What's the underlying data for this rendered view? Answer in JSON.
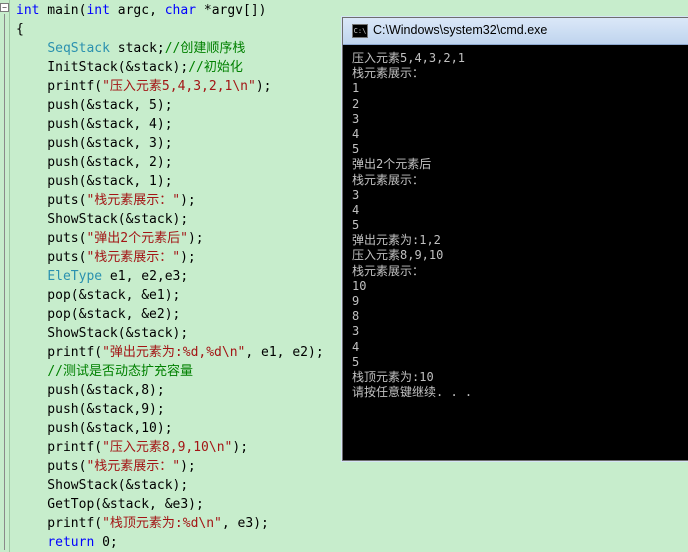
{
  "editor": {
    "lines": [
      [
        {
          "t": "int",
          "c": "kw"
        },
        {
          "t": " main(",
          "c": ""
        },
        {
          "t": "int",
          "c": "kw"
        },
        {
          "t": " argc, ",
          "c": ""
        },
        {
          "t": "char",
          "c": "kw"
        },
        {
          "t": " *argv[])",
          "c": ""
        }
      ],
      [
        {
          "t": "{",
          "c": ""
        }
      ],
      [
        {
          "t": "    ",
          "c": ""
        },
        {
          "t": "SeqStack",
          "c": "ty"
        },
        {
          "t": " stack;",
          "c": ""
        },
        {
          "t": "//创建顺序栈",
          "c": "cm"
        }
      ],
      [
        {
          "t": "    InitStack(&stack);",
          "c": ""
        },
        {
          "t": "//初始化",
          "c": "cm"
        }
      ],
      [
        {
          "t": "    printf(",
          "c": ""
        },
        {
          "t": "\"压入元素5,4,3,2,1\\n\"",
          "c": "str"
        },
        {
          "t": ");",
          "c": ""
        }
      ],
      [
        {
          "t": "    push(&stack, 5);",
          "c": ""
        }
      ],
      [
        {
          "t": "    push(&stack, 4);",
          "c": ""
        }
      ],
      [
        {
          "t": "    push(&stack, 3);",
          "c": ""
        }
      ],
      [
        {
          "t": "    push(&stack, 2);",
          "c": ""
        }
      ],
      [
        {
          "t": "    push(&stack, 1);",
          "c": ""
        }
      ],
      [
        {
          "t": "    puts(",
          "c": ""
        },
        {
          "t": "\"栈元素展示：\"",
          "c": "str"
        },
        {
          "t": ");",
          "c": ""
        }
      ],
      [
        {
          "t": "    ShowStack(&stack);",
          "c": ""
        }
      ],
      [
        {
          "t": "    puts(",
          "c": ""
        },
        {
          "t": "\"弹出2个元素后\"",
          "c": "str"
        },
        {
          "t": ");",
          "c": ""
        }
      ],
      [
        {
          "t": "    puts(",
          "c": ""
        },
        {
          "t": "\"栈元素展示：\"",
          "c": "str"
        },
        {
          "t": ");",
          "c": ""
        }
      ],
      [
        {
          "t": "    ",
          "c": ""
        },
        {
          "t": "EleType",
          "c": "ty"
        },
        {
          "t": " e1, e2,e3;",
          "c": ""
        }
      ],
      [
        {
          "t": "    pop(&stack, &e1);",
          "c": ""
        }
      ],
      [
        {
          "t": "    pop(&stack, &e2);",
          "c": ""
        }
      ],
      [
        {
          "t": "    ShowStack(&stack);",
          "c": ""
        }
      ],
      [
        {
          "t": "    printf(",
          "c": ""
        },
        {
          "t": "\"弹出元素为:%d,%d\\n\"",
          "c": "str"
        },
        {
          "t": ", e1, e2);",
          "c": ""
        }
      ],
      [
        {
          "t": "    ",
          "c": ""
        },
        {
          "t": "//测试是否动态扩充容量",
          "c": "cm"
        }
      ],
      [
        {
          "t": "    push(&stack,8);",
          "c": ""
        }
      ],
      [
        {
          "t": "    push(&stack,9);",
          "c": ""
        }
      ],
      [
        {
          "t": "    push(&stack,10);",
          "c": ""
        }
      ],
      [
        {
          "t": "    printf(",
          "c": ""
        },
        {
          "t": "\"压入元素8,9,10\\n\"",
          "c": "str"
        },
        {
          "t": ");",
          "c": ""
        }
      ],
      [
        {
          "t": "    puts(",
          "c": ""
        },
        {
          "t": "\"栈元素展示：\"",
          "c": "str"
        },
        {
          "t": ");",
          "c": ""
        }
      ],
      [
        {
          "t": "    ShowStack(&stack);",
          "c": ""
        }
      ],
      [
        {
          "t": "    GetTop(&stack, &e3);",
          "c": ""
        }
      ],
      [
        {
          "t": "    printf(",
          "c": ""
        },
        {
          "t": "\"栈顶元素为:%d\\n\"",
          "c": "str"
        },
        {
          "t": ", e3);",
          "c": ""
        }
      ],
      [
        {
          "t": "    ",
          "c": ""
        },
        {
          "t": "return",
          "c": "kw"
        },
        {
          "t": " 0;",
          "c": ""
        }
      ]
    ]
  },
  "cmd": {
    "title": "C:\\Windows\\system32\\cmd.exe",
    "icon": "cmd-icon",
    "output": [
      "压入元素5,4,3,2,1",
      "栈元素展示：",
      "1",
      "2",
      "3",
      "4",
      "5",
      "弹出2个元素后",
      "栈元素展示：",
      "3",
      "4",
      "5",
      "弹出元素为:1,2",
      "压入元素8,9,10",
      "栈元素展示：",
      "10",
      "9",
      "8",
      "3",
      "4",
      "5",
      "栈顶元素为:10",
      "请按任意键继续. . ."
    ]
  }
}
